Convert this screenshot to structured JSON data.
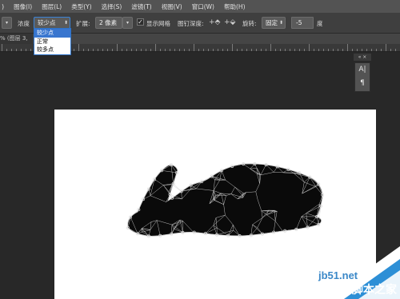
{
  "menu": {
    "lead": ")",
    "items": [
      "图像(I)",
      "图层(L)",
      "类型(Y)",
      "选择(S)",
      "滤镜(T)",
      "视图(V)",
      "窗口(W)",
      "帮助(H)"
    ]
  },
  "options": {
    "density_label": "浓度",
    "density_value": "较少点",
    "expand_label": "扩展:",
    "expand_value": "2 像素",
    "show_mesh_label": "显示网格",
    "show_mesh_checked": true,
    "pin_depth_label": "图钉深度:",
    "rotate_label": "旋转:",
    "rotate_value": "固定",
    "angle_value": "-5",
    "angle_unit": "度"
  },
  "density_dropdown": {
    "options": [
      "较少点",
      "正常",
      "较多点"
    ],
    "selected_index": 0
  },
  "document": {
    "tab_title": "% (图层 3, "
  },
  "side_panel": {
    "header": "« ×",
    "icons": [
      "character-icon",
      "paragraph-icon"
    ],
    "glyphs": [
      "A|",
      "¶"
    ]
  },
  "watermark": {
    "url": "jb51.net",
    "name": "脚本之家"
  },
  "colors": {
    "menubar": "#535353",
    "optionbar": "#3f3f3f",
    "workspace": "#282828",
    "selection": "#3976cf",
    "mesh": "#cfcfcf"
  }
}
